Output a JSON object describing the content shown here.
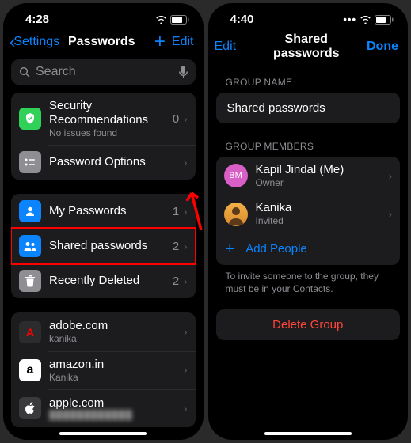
{
  "left": {
    "time": "4:28",
    "back": "Settings",
    "title": "Passwords",
    "edit": "Edit",
    "search_placeholder": "Search",
    "sec_rec": {
      "title": "Security Recommendations",
      "sub": "No issues found",
      "count": "0"
    },
    "pwd_options": "Password Options",
    "my_passwords": {
      "label": "My Passwords",
      "count": "1"
    },
    "shared": {
      "label": "Shared passwords",
      "count": "2"
    },
    "deleted": {
      "label": "Recently Deleted",
      "count": "2"
    },
    "sites": [
      {
        "domain": "adobe.com",
        "user": "kanika"
      },
      {
        "domain": "amazon.in",
        "user": "Kanika"
      },
      {
        "domain": "apple.com",
        "user": ""
      }
    ]
  },
  "right": {
    "time": "4:40",
    "edit": "Edit",
    "title": "Shared passwords",
    "done": "Done",
    "group_name_header": "GROUP NAME",
    "group_name_value": "Shared passwords",
    "members_header": "GROUP MEMBERS",
    "members": [
      {
        "initials": "BM",
        "name": "Kapil Jindal (Me)",
        "role": "Owner",
        "color": "#d85fc5"
      },
      {
        "initials": "",
        "name": "Kanika",
        "role": "Invited",
        "color": "#f2b14a"
      }
    ],
    "add_people": "Add People",
    "footer": "To invite someone to the group, they must be in your Contacts.",
    "delete": "Delete Group"
  }
}
